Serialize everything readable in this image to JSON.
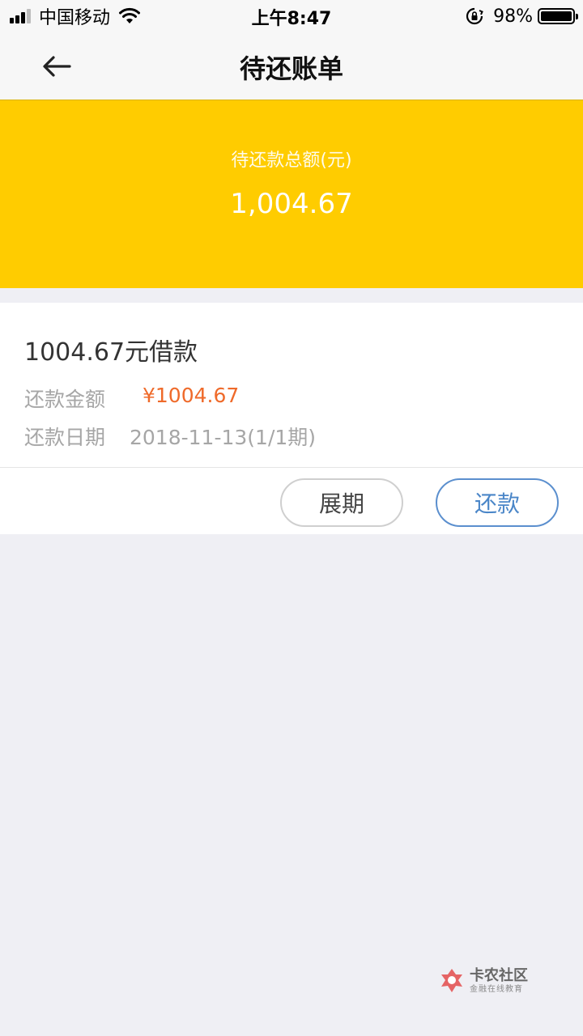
{
  "status_bar": {
    "carrier": "中国移动",
    "time": "上午8:47",
    "battery": "98%"
  },
  "nav": {
    "title": "待还账单"
  },
  "summary": {
    "label": "待还款总额(元)",
    "amount": "1,004.67"
  },
  "bill": {
    "title": "1004.67元借款",
    "amount_label": "还款金额",
    "amount_value": "¥1004.67",
    "date_label": "还款日期",
    "date_value": "2018-11-13(1/1期)"
  },
  "actions": {
    "extend_label": "展期",
    "repay_label": "还款"
  },
  "watermark": {
    "main": "卡农社区",
    "sub": "金融在线教育"
  },
  "colors": {
    "accent_yellow": "#ffcc00",
    "amount_orange": "#ef6a2a",
    "repay_blue": "#4a86c8"
  }
}
